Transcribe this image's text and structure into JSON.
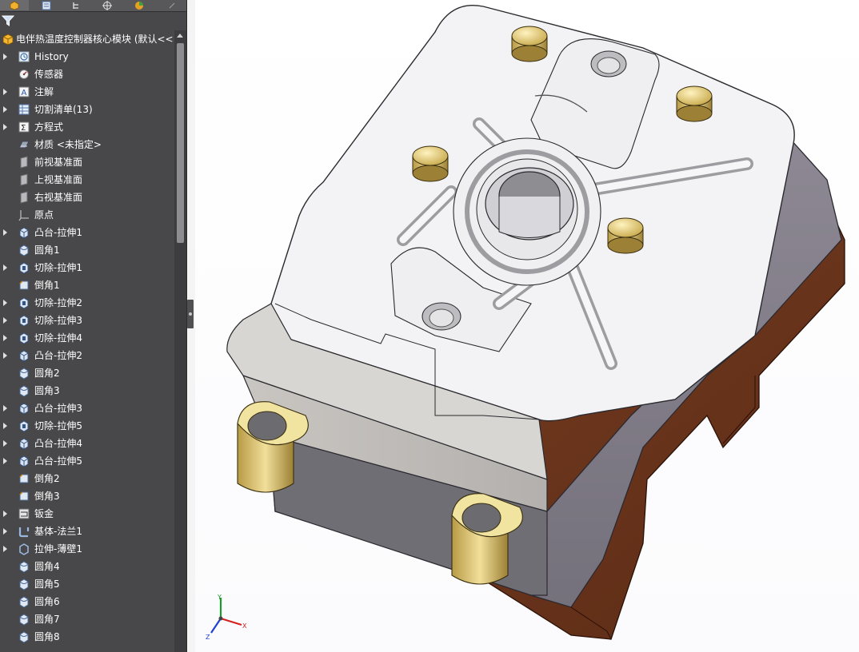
{
  "tabs": [
    {
      "icon": "feature-manager-icon",
      "active": true
    },
    {
      "icon": "property-manager-icon",
      "active": false
    },
    {
      "icon": "configuration-manager-icon",
      "active": false
    },
    {
      "icon": "dimxpert-icon",
      "active": false
    },
    {
      "icon": "display-manager-icon",
      "active": false
    }
  ],
  "tree": {
    "root_label": "电伴热温度控制器核心模块  (默认<<",
    "items": [
      {
        "label": "History",
        "icon": "history-icon",
        "arrow": true
      },
      {
        "label": "传感器",
        "icon": "sensor-icon",
        "arrow": false
      },
      {
        "label": "注解",
        "icon": "annotation-icon",
        "arrow": true
      },
      {
        "label": "切割清单(13)",
        "icon": "cut-list-icon",
        "arrow": true
      },
      {
        "label": "方程式",
        "icon": "equation-icon",
        "arrow": true
      },
      {
        "label": "材质 <未指定>",
        "icon": "material-icon",
        "arrow": false
      },
      {
        "label": "前视基准面",
        "icon": "plane-icon",
        "arrow": false
      },
      {
        "label": "上视基准面",
        "icon": "plane-icon",
        "arrow": false
      },
      {
        "label": "右视基准面",
        "icon": "plane-icon",
        "arrow": false
      },
      {
        "label": "原点",
        "icon": "origin-icon",
        "arrow": false
      },
      {
        "label": "凸台-拉伸1",
        "icon": "boss-extrude-icon",
        "arrow": true
      },
      {
        "label": "圆角1",
        "icon": "fillet-icon",
        "arrow": false
      },
      {
        "label": "切除-拉伸1",
        "icon": "cut-extrude-icon",
        "arrow": true
      },
      {
        "label": "倒角1",
        "icon": "chamfer-icon",
        "arrow": false
      },
      {
        "label": "切除-拉伸2",
        "icon": "cut-extrude-icon",
        "arrow": true
      },
      {
        "label": "切除-拉伸3",
        "icon": "cut-extrude-icon",
        "arrow": true
      },
      {
        "label": "切除-拉伸4",
        "icon": "cut-extrude-icon",
        "arrow": true
      },
      {
        "label": "凸台-拉伸2",
        "icon": "boss-extrude-icon",
        "arrow": true
      },
      {
        "label": "圆角2",
        "icon": "fillet-icon",
        "arrow": false
      },
      {
        "label": "圆角3",
        "icon": "fillet-icon",
        "arrow": false
      },
      {
        "label": "凸台-拉伸3",
        "icon": "boss-extrude-icon",
        "arrow": true
      },
      {
        "label": "切除-拉伸5",
        "icon": "cut-extrude-icon",
        "arrow": true
      },
      {
        "label": "凸台-拉伸4",
        "icon": "boss-extrude-icon",
        "arrow": true
      },
      {
        "label": "凸台-拉伸5",
        "icon": "boss-extrude-icon",
        "arrow": true
      },
      {
        "label": "倒角2",
        "icon": "chamfer-icon",
        "arrow": false
      },
      {
        "label": "倒角3",
        "icon": "chamfer-icon",
        "arrow": false
      },
      {
        "label": "钣金",
        "icon": "sheet-metal-icon",
        "arrow": true
      },
      {
        "label": "基体-法兰1",
        "icon": "base-flange-icon",
        "arrow": true
      },
      {
        "label": "拉伸-薄壁1",
        "icon": "thin-extrude-icon",
        "arrow": true
      },
      {
        "label": "圆角4",
        "icon": "fillet-icon",
        "arrow": false
      },
      {
        "label": "圆角5",
        "icon": "fillet-icon",
        "arrow": false
      },
      {
        "label": "圆角6",
        "icon": "fillet-icon",
        "arrow": false
      },
      {
        "label": "圆角7",
        "icon": "fillet-icon",
        "arrow": false
      },
      {
        "label": "圆角8",
        "icon": "fillet-icon",
        "arrow": false
      }
    ]
  },
  "triad": {
    "x_label": "X",
    "y_label": "Y",
    "z_label": "Z"
  },
  "colors": {
    "panel_bg": "#48484a",
    "top_plate": "#f3f3f5",
    "body_gray": "#8f8c93",
    "base_brown": "#7a3d22",
    "pin_yellow": "#e0c977"
  }
}
